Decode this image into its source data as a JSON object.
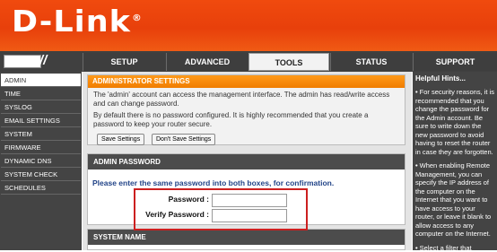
{
  "brand": {
    "name": "D-Link",
    "reg": "®"
  },
  "nav": {
    "slashes": "//",
    "tabs": [
      "SETUP",
      "ADVANCED",
      "TOOLS",
      "STATUS",
      "SUPPORT"
    ],
    "active_tab": "TOOLS"
  },
  "sidebar": {
    "items": [
      "ADMIN",
      "TIME",
      "SYSLOG",
      "EMAIL SETTINGS",
      "SYSTEM",
      "FIRMWARE",
      "DYNAMIC DNS",
      "SYSTEM CHECK",
      "SCHEDULES"
    ],
    "active": "ADMIN"
  },
  "admin_settings": {
    "title": "ADMINISTRATOR SETTINGS",
    "text1": "The 'admin' account can access the management interface. The admin has read/write access and can change password.",
    "text2": "By default there is no password configured. It is highly recommended that you create a password to keep your router secure.",
    "save_label": "Save Settings",
    "dont_save_label": "Don't Save Settings"
  },
  "admin_password": {
    "title": "ADMIN PASSWORD",
    "instruction": "Please enter the same password into both boxes, for confirmation.",
    "password_label": "Password :",
    "verify_label": "Verify Password :",
    "password_value": "",
    "verify_value": ""
  },
  "system_name": {
    "title": "SYSTEM NAME"
  },
  "hints": {
    "title": "Helpful Hints...",
    "items": [
      "For security reasons, it is recommended that you change the password for the Admin account. Be sure to write down the new password to avoid having to reset the router in case they are forgotten.",
      "When enabling Remote Management, you can specify the IP address of the computer on the Internet that you want to have access to your router, or leave it blank to allow access to any computer on the Internet.",
      "Select a filter that"
    ]
  },
  "colors": {
    "brand_orange": "#ee4610",
    "section_orange": "#f58a0a",
    "nav_dark": "#404040",
    "highlight_red": "#cc1f1f"
  }
}
